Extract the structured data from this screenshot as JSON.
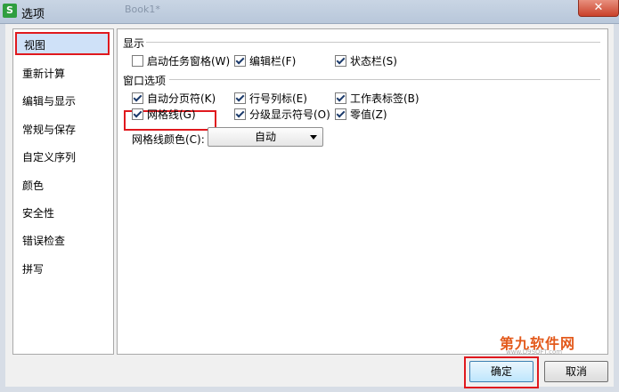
{
  "window": {
    "title": "选项",
    "app_icon": "S",
    "bg_tab": "Book1*",
    "close_symbol": "✕"
  },
  "sidebar": {
    "items": [
      {
        "label": "视图",
        "selected": true
      },
      {
        "label": "重新计算"
      },
      {
        "label": "编辑与显示"
      },
      {
        "label": "常规与保存"
      },
      {
        "label": "自定义序列"
      },
      {
        "label": "颜色"
      },
      {
        "label": "安全性"
      },
      {
        "label": "错误检查"
      },
      {
        "label": "拼写"
      }
    ]
  },
  "display": {
    "title": "显示",
    "options": [
      {
        "label": "启动任务窗格(W)",
        "checked": false
      },
      {
        "label": "编辑栏(F)",
        "checked": true
      },
      {
        "label": "状态栏(S)",
        "checked": true
      }
    ]
  },
  "window_options": {
    "title": "窗口选项",
    "options": [
      {
        "label": "自动分页符(K)",
        "checked": true
      },
      {
        "label": "行号列标(E)",
        "checked": true
      },
      {
        "label": "工作表标签(B)",
        "checked": true
      },
      {
        "label": "网格线(G)",
        "checked": true
      },
      {
        "label": "分级显示符号(O)",
        "checked": true
      },
      {
        "label": "零值(Z)",
        "checked": true
      }
    ]
  },
  "grid_color": {
    "label": "网格线颜色(C):",
    "value": "自动"
  },
  "watermark": {
    "logo": "第九软件网",
    "url": "www.D9SOFT.com"
  },
  "buttons": {
    "ok": "确定",
    "cancel": "取消"
  },
  "colors": {
    "highlight_red": "#e0191e",
    "selection_blue": "#cfe1f8"
  }
}
